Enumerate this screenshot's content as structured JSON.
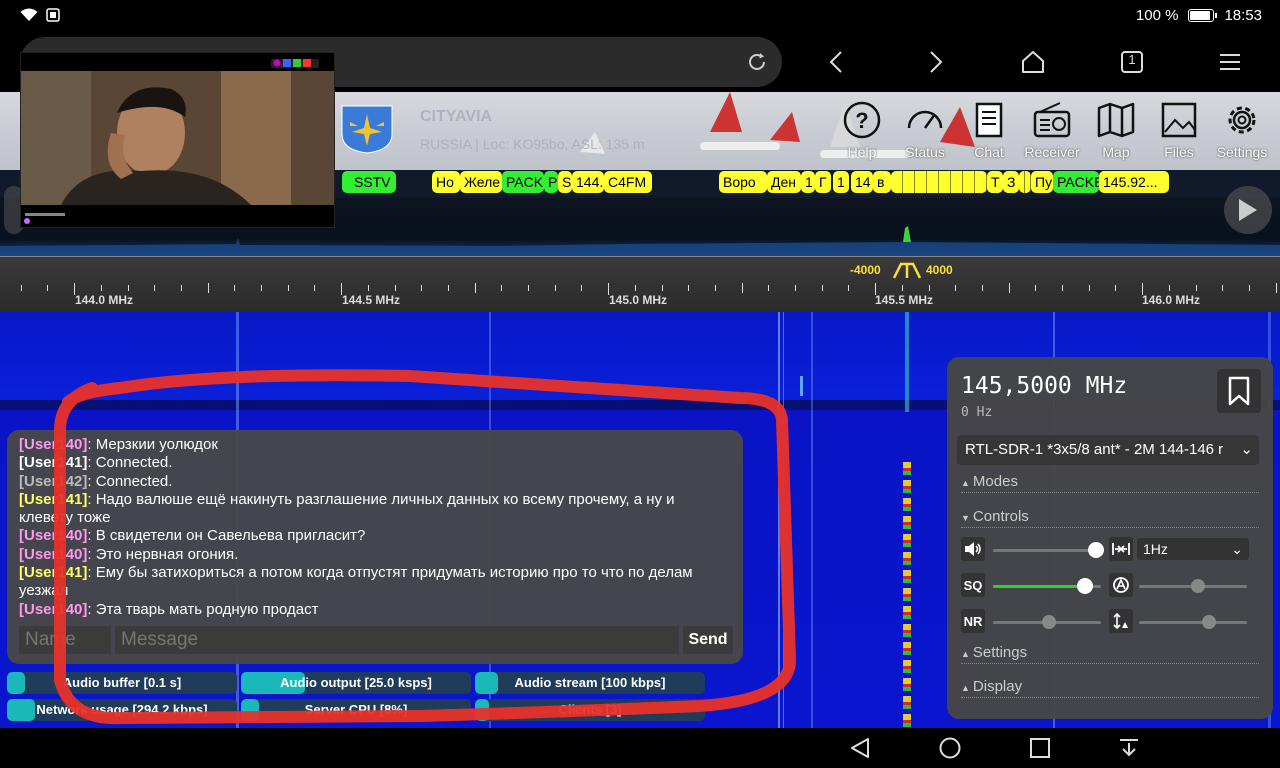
{
  "statusbar": {
    "battery_text": "100 %",
    "time": "18:53"
  },
  "browser": {
    "tab_count": "1"
  },
  "receiver": {
    "title": "CITYAVIA",
    "subtitle": "RUSSIA | Loc: KO95bo, ASL: 135 m",
    "tools": [
      {
        "label": "Help",
        "icon": "help-icon"
      },
      {
        "label": "Status",
        "icon": "gauge-icon"
      },
      {
        "label": "Chat",
        "icon": "chat-icon"
      },
      {
        "label": "Receiver",
        "icon": "radio-icon"
      },
      {
        "label": "Map",
        "icon": "map-icon"
      },
      {
        "label": "Files",
        "icon": "image-icon"
      },
      {
        "label": "Settings",
        "icon": "gear-icon"
      }
    ]
  },
  "bookmarks": [
    "SSTV",
    "Но",
    "Желе",
    "PACK",
    "P",
    "S",
    "144.",
    "C4FM",
    "Воро",
    "Ден",
    "1",
    "Г",
    "1",
    "14",
    "в",
    "Т",
    "З",
    "Пу",
    "PACKE",
    "145.92..."
  ],
  "scale": {
    "labels": [
      "144.0 MHz",
      "144.5 MHz",
      "145.0 MHz",
      "145.5 MHz",
      "146.0 MHz"
    ],
    "filter_low": "-4000",
    "filter_high": "4000"
  },
  "chat": {
    "messages": [
      {
        "user": "User140",
        "visible_user": "[Use",
        "hidden": "r140",
        "text": ": Мерзкии уолюдок",
        "color": "#ff99ee"
      },
      {
        "user": "User141",
        "visible_user": "[User141]",
        "text": ": Connected.",
        "color": "#ffffff"
      },
      {
        "user": "User142",
        "visible_user": "[User142]",
        "text": ": Connected.",
        "color": "#bbbbbb"
      },
      {
        "user": "User141",
        "visible_user": "[User141]",
        "text": ": Надо валюше ещё накинуть разглашение личных данных ко всему прочему, а ну и клевету тоже",
        "color": "#ffff66"
      },
      {
        "user": "User140",
        "visible_user": "[User140]",
        "text": ": В свидетели он Савельева пригласит?",
        "color": "#ff99ee"
      },
      {
        "user": "User140",
        "visible_user": "[User140]",
        "text": ": Это нервная огония.",
        "color": "#ff99ee"
      },
      {
        "user": "User141",
        "visible_user": "[User141]",
        "text": ": Ему бы затихориться а потом когда отпустят придумать историю про то что по делам уезжал",
        "color": "#ffff66"
      },
      {
        "user": "User140",
        "visible_user": "[User140]",
        "text": ": Эта тварь мать родную продаст",
        "color": "#ff99ee"
      }
    ],
    "name_placeholder": "Name",
    "message_placeholder": "Message",
    "send_label": "Send"
  },
  "status_bars": [
    {
      "label": "Audio buffer [0.1 s]",
      "fill": 0.08
    },
    {
      "label": "Audio output [25.0 ksps]",
      "fill": 0.28
    },
    {
      "label": "Audio stream [100 kbps]",
      "fill": 0.1
    },
    {
      "label": "Network usage [294.2 kbps]",
      "fill": 0.12
    },
    {
      "label": "Server CPU [8%]",
      "fill": 0.08
    },
    {
      "label": "Clients [3]",
      "fill": 0.06
    }
  ],
  "panel": {
    "frequency": "145,5000 MHz",
    "offset": "0 Hz",
    "profile": "RTL-SDR-1 *3x5/8 ant* - 2M 144-146 r",
    "sections": {
      "modes": "Modes",
      "controls": "Controls",
      "settings": "Settings",
      "display": "Display"
    },
    "step": "1Hz",
    "volume": 0.88,
    "squelch": 0.78,
    "nr": 0.5,
    "agc": 0.5,
    "tune": 0.6
  },
  "colors": {
    "waterfall": "#0a13c8",
    "bookmark_yellow": "#ffff30",
    "bookmark_green": "#33ee33",
    "annotation": "#e8322a"
  }
}
